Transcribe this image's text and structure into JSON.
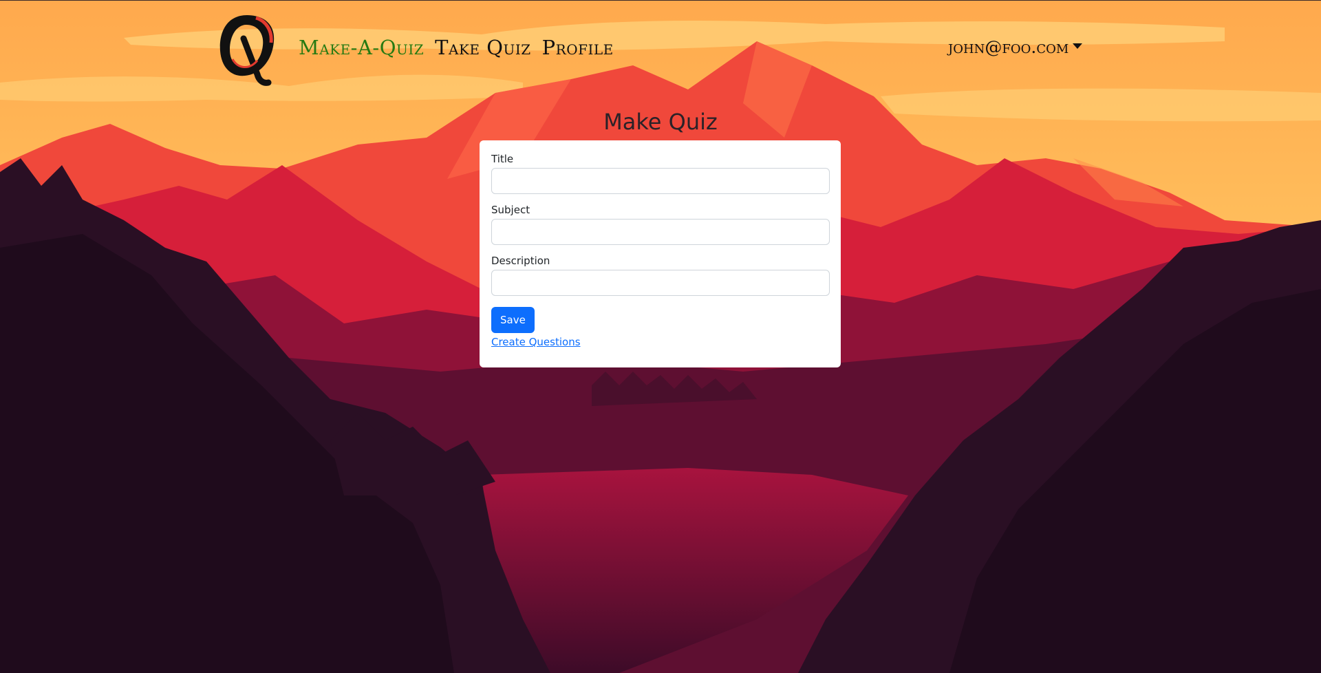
{
  "nav": {
    "links": [
      {
        "label": "Make-A-Quiz",
        "active": true
      },
      {
        "label": "Take Quiz",
        "active": false
      },
      {
        "label": "Profile",
        "active": false
      }
    ],
    "user_email": "john@foo.com",
    "logo_icon": "quiz-q-logo-icon"
  },
  "page": {
    "title": "Make Quiz"
  },
  "form": {
    "title_label": "Title",
    "title_value": "",
    "subject_label": "Subject",
    "subject_value": "",
    "description_label": "Description",
    "description_value": "",
    "save_label": "Save",
    "create_questions_label": "Create Questions"
  },
  "colors": {
    "nav_active": "#267a12",
    "primary_button": "#0d6efd",
    "sky": "#ffb35a"
  }
}
